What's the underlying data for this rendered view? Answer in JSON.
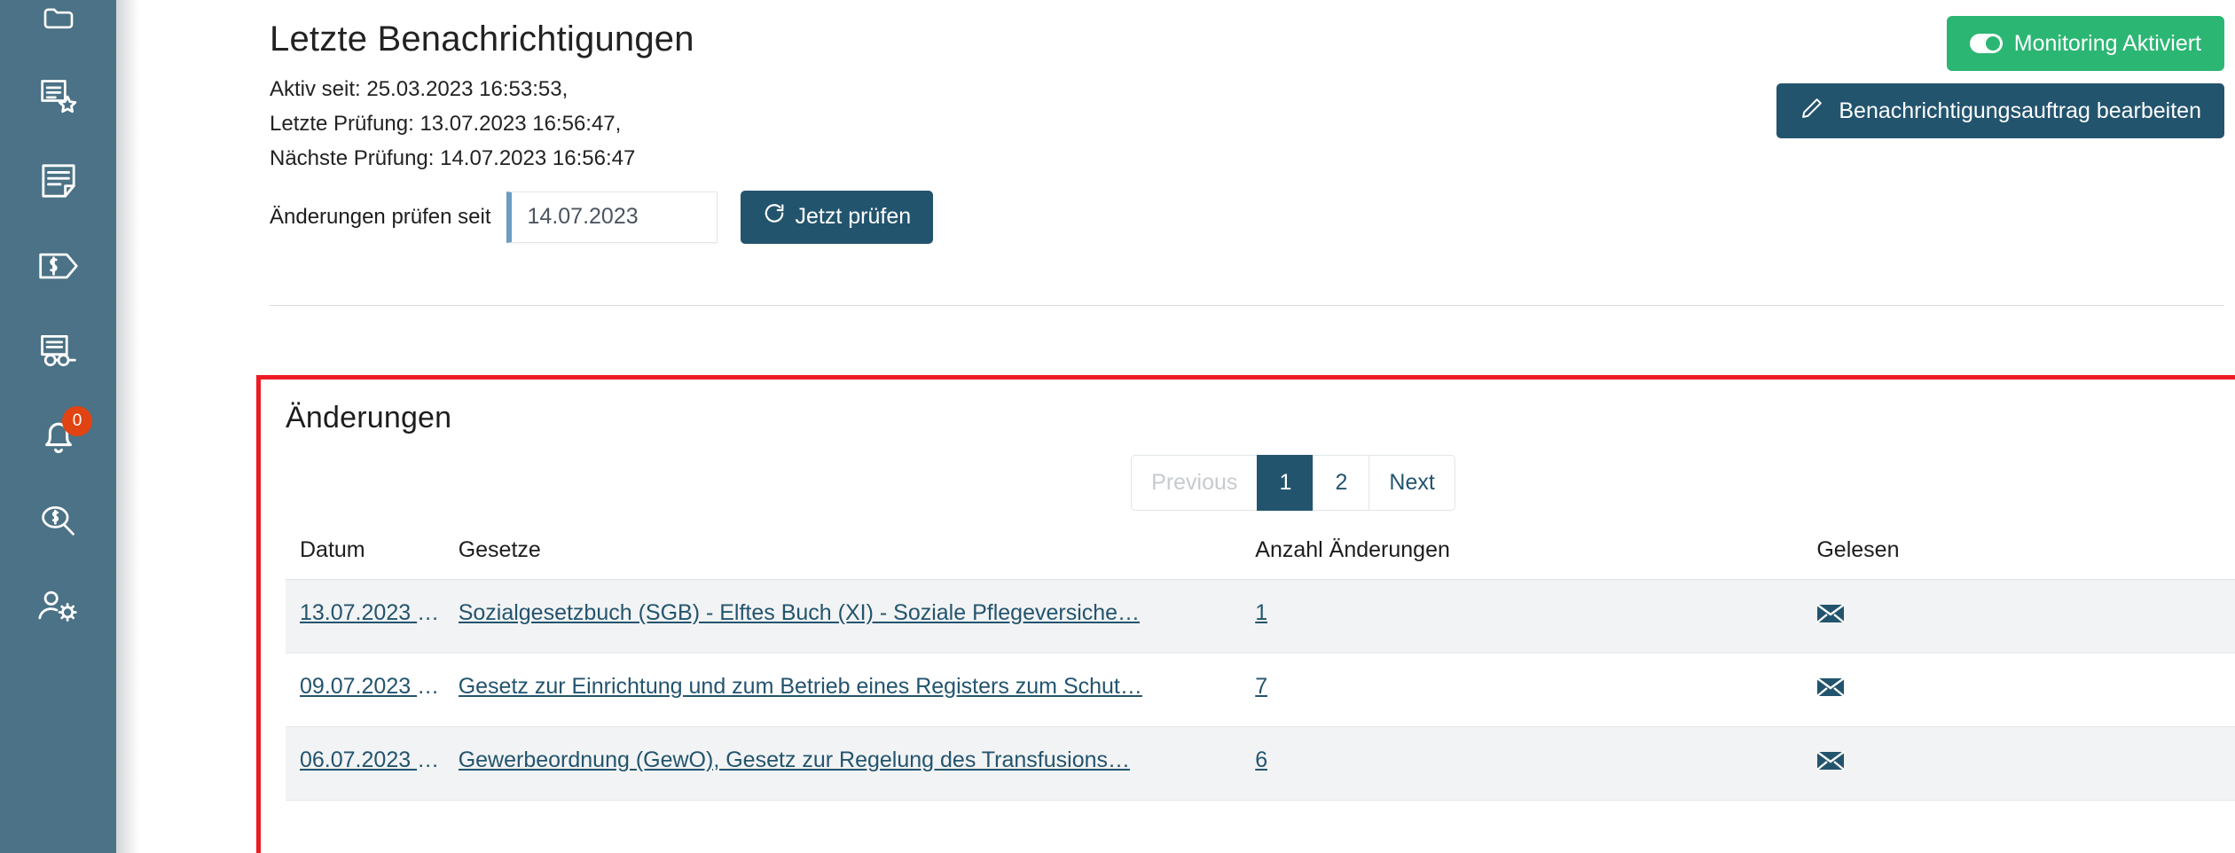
{
  "sidebar": {
    "items": [
      {
        "name": "folder-icon",
        "label": "Akten"
      },
      {
        "name": "document-star-icon",
        "label": "Favoriten"
      },
      {
        "name": "document-note-icon",
        "label": "Notizen"
      },
      {
        "name": "paragraph-tag-icon",
        "label": "Gesetze"
      },
      {
        "name": "document-glasses-icon",
        "label": "Lesen"
      },
      {
        "name": "bell-icon",
        "label": "Benachrichtigungen",
        "badge": "0"
      },
      {
        "name": "paragraph-search-icon",
        "label": "Suche"
      },
      {
        "name": "user-settings-icon",
        "label": "Benutzereinstellungen"
      }
    ]
  },
  "header": {
    "title": "Letzte Benachrichtigungen",
    "meta_lines": [
      "Aktiv seit: 25.03.2023 16:53:53,",
      "Letzte Prüfung: 13.07.2023 16:56:47,",
      "Nächste Prüfung: 14.07.2023 16:56:47"
    ],
    "check_label": "Änderungen prüfen seit",
    "date_value": "14.07.2023",
    "check_button": "Jetzt prüfen",
    "monitoring_button": "Monitoring Aktiviert",
    "edit_button": "Benachrichtigungsauftrag bearbeiten"
  },
  "changes": {
    "title": "Änderungen",
    "pagination": {
      "previous": "Previous",
      "pages": [
        "1",
        "2"
      ],
      "active_page": "1",
      "next": "Next"
    },
    "columns": {
      "datum": "Datum",
      "gesetze": "Gesetze",
      "anzahl": "Anzahl Änderungen",
      "gelesen": "Gelesen"
    },
    "rows": [
      {
        "datum": "13.07.2023 1…",
        "gesetze": "Sozialgesetzbuch (SGB) - Elftes Buch (XI) - Soziale Pflegeversiche…",
        "anzahl": "1",
        "gelesen_icon": "envelope-icon",
        "delete_icon": "trash-icon"
      },
      {
        "datum": "09.07.2023 1…",
        "gesetze": "Gesetz zur Einrichtung und zum Betrieb eines Registers zum Schut…",
        "anzahl": "7",
        "gelesen_icon": "envelope-icon",
        "delete_icon": "trash-icon"
      },
      {
        "datum": "06.07.2023 1…",
        "gesetze": "Gewerbeordnung (GewO), Gesetz zur Regelung des Transfusions…",
        "anzahl": "6",
        "gelesen_icon": "envelope-icon",
        "delete_icon": "trash-icon"
      }
    ]
  },
  "colors": {
    "sidebar": "#4b7286",
    "primary": "#23546e",
    "success": "#2bb673",
    "badge": "#e14312",
    "highlight_border": "#ed1c24",
    "link": "#23546e"
  }
}
